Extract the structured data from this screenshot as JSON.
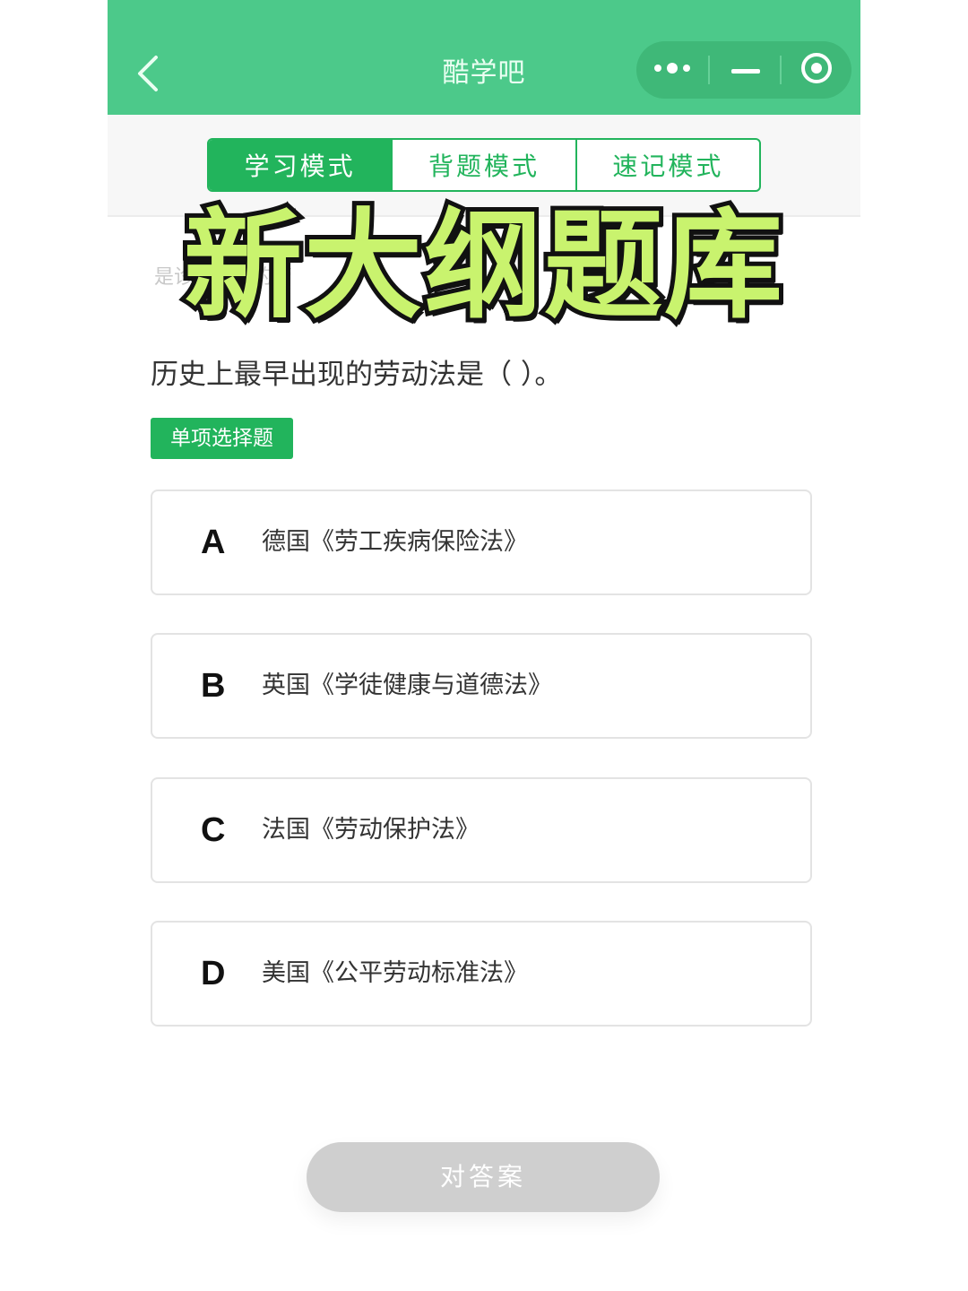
{
  "header": {
    "title": "酷学吧",
    "back_icon": "chevron-left-icon",
    "capsule": {
      "more_icon": "more-dots-icon",
      "minimize_icon": "minimize-icon",
      "close_icon": "target-circle-icon"
    }
  },
  "mode_tabs": [
    {
      "label": "学习模式",
      "active": true
    },
    {
      "label": "背题模式",
      "active": false
    },
    {
      "label": "速记模式",
      "active": false
    }
  ],
  "overlay_headline": "新大纲题库",
  "faded_text": "是诊断…方的管",
  "question": {
    "text": "历史上最早出现的劳动法是（   ）。",
    "type_label": "单项选择题"
  },
  "options": [
    {
      "letter": "A",
      "text": "德国《劳工疾病保险法》"
    },
    {
      "letter": "B",
      "text": "英国《学徒健康与道德法》"
    },
    {
      "letter": "C",
      "text": "法国《劳动保护法》"
    },
    {
      "letter": "D",
      "text": "美国《公平劳动标准法》"
    }
  ],
  "submit_label": "对答案",
  "colors": {
    "header_green": "#4cc98a",
    "accent_green": "#22b45c",
    "headline_fill": "#c9f36e",
    "disabled_gray": "#cfcfcf"
  }
}
